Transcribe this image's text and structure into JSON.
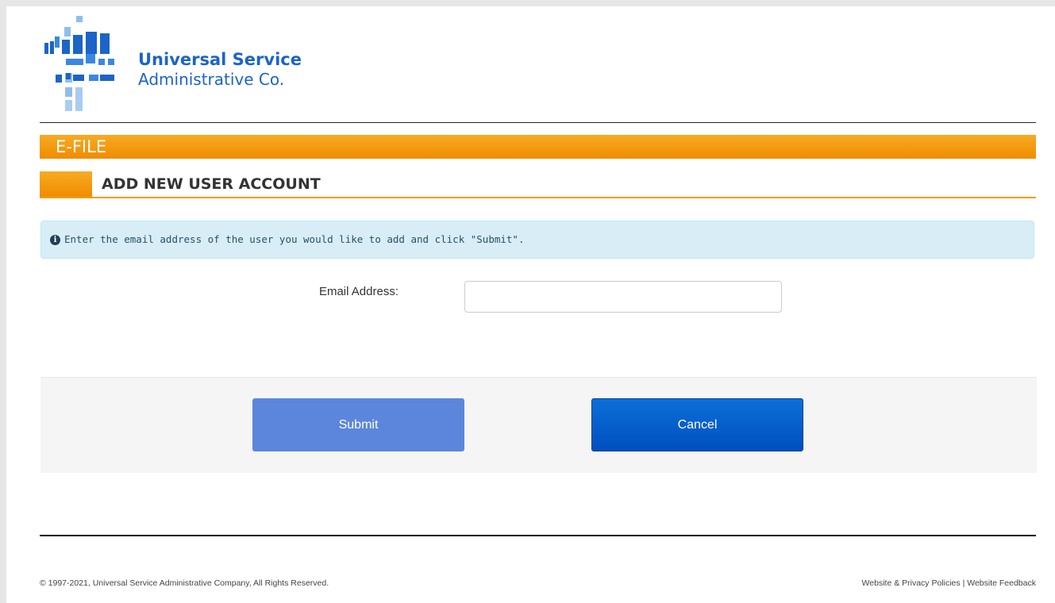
{
  "brand": {
    "line1": "Universal Service",
    "line2": "Administrative Co.",
    "colors": {
      "light": "#7fb3ea",
      "mid": "#3b87e0",
      "dark": "#1c64c7"
    }
  },
  "bar_title": "E-FILE",
  "section_title": "ADD NEW USER ACCOUNT",
  "alert": {
    "icon": "info-circle-icon",
    "text": "Enter the email address of the user you would like to add and click \"Submit\"."
  },
  "form": {
    "email_label": "Email Address:",
    "email_value": "",
    "email_placeholder": ""
  },
  "buttons": {
    "submit": "Submit",
    "cancel": "Cancel"
  },
  "footer": {
    "copyright": "© 1997-2021, Universal Service Administrative Company, All Rights Reserved.",
    "privacy": "Website & Privacy Policies",
    "separator": " | ",
    "feedback": "Website Feedback"
  },
  "colors": {
    "accent_orange": "#f39c12",
    "alert_bg": "#d9edf7",
    "submit_bg": "#5b86dc",
    "cancel_bg": "#0d6fd8"
  }
}
